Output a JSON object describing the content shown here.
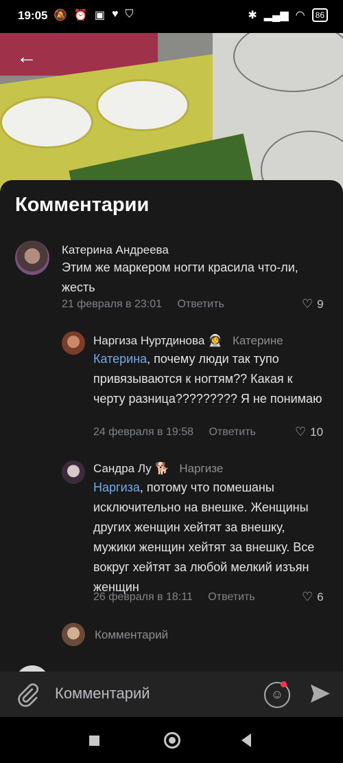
{
  "status": {
    "time": "19:05",
    "battery": "86"
  },
  "sheet": {
    "title": "Комментарии"
  },
  "comments": [
    {
      "author": "Катерина Андреева",
      "text": "Этим же маркером ногти красила что-ли, жесть",
      "date": "21 февраля в 23:01",
      "reply_label": "Ответить",
      "likes": "9"
    },
    {
      "author": "Наргиза Нуртдинова",
      "author_emoji": "👩‍🚀",
      "reply_to": "Катерине",
      "mention": "Катерина",
      "text": ", почему люди так тупо привязываются к ногтям?? Какая к черту разница????????? Я не понимаю",
      "date": "24 февраля в 19:58",
      "reply_label": "Ответить",
      "likes": "10"
    },
    {
      "author": "Сандра Лу",
      "author_emoji": "🐕",
      "reply_to": "Наргизе",
      "mention": "Наргиза",
      "text": ", потому что помешаны исключительно на внешке. Женщины других женщин хейтят за внешку, мужики женщин хейтят за внешку. Все вокруг хейтят за любой мелкий изъян женщин",
      "date": "26 февраля в 18:11",
      "reply_label": "Ответить",
      "likes": "6"
    }
  ],
  "reply_input": {
    "placeholder": "Комментарий"
  },
  "bottom_bar": {
    "placeholder": "Комментарий"
  },
  "icons": {
    "back": "arrow-left-icon",
    "attach": "paperclip-icon",
    "emoji": "smile-icon",
    "send": "send-icon",
    "heart": "heart-icon"
  },
  "colors": {
    "accent": "#71aaeb",
    "sheet_bg": "#19191a",
    "bar_bg": "#232324"
  }
}
